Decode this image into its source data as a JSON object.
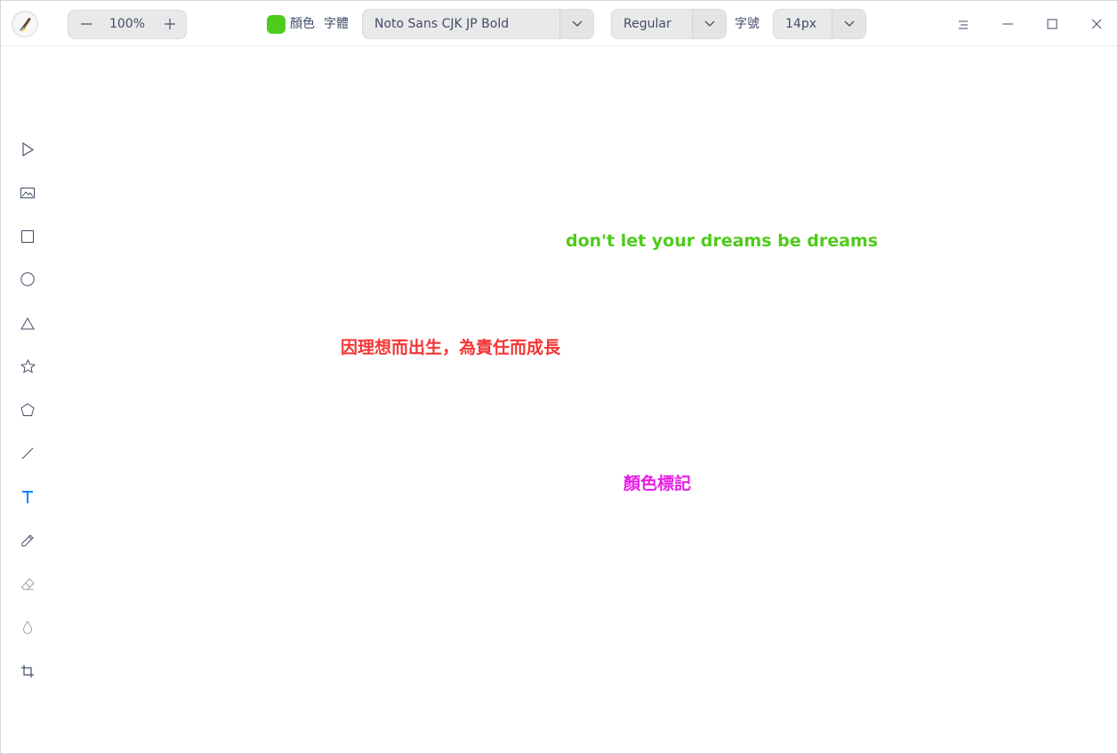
{
  "titlebar": {
    "zoom": {
      "value": "100%",
      "minus_icon": "minus-icon",
      "plus_icon": "plus-icon"
    },
    "color_label": "顏色",
    "color_value": "#4ecb1c",
    "font_label": "字體",
    "font_family": "Noto Sans CJK JP Bold",
    "font_weight": "Regular",
    "size_label": "字號",
    "font_size": "14px"
  },
  "window_controls": [
    "menu-icon",
    "minimize-icon",
    "maximize-icon",
    "close-icon"
  ],
  "tools": [
    {
      "name": "select",
      "icon": "select-arrow-icon",
      "active": false
    },
    {
      "name": "image",
      "icon": "image-icon",
      "active": false
    },
    {
      "name": "rectangle",
      "icon": "rectangle-icon",
      "active": false
    },
    {
      "name": "ellipse",
      "icon": "ellipse-icon",
      "active": false
    },
    {
      "name": "triangle",
      "icon": "triangle-icon",
      "active": false
    },
    {
      "name": "star",
      "icon": "star-icon",
      "active": false
    },
    {
      "name": "polygon",
      "icon": "polygon-icon",
      "active": false
    },
    {
      "name": "line",
      "icon": "line-icon",
      "active": false
    },
    {
      "name": "text",
      "icon": "text-icon",
      "active": true
    },
    {
      "name": "pen",
      "icon": "pen-icon",
      "active": false
    },
    {
      "name": "eraser",
      "icon": "eraser-icon",
      "active": false
    },
    {
      "name": "blur",
      "icon": "blur-drop-icon",
      "active": false
    },
    {
      "name": "crop",
      "icon": "crop-icon",
      "active": false
    }
  ],
  "canvas": {
    "texts": [
      {
        "text": "don't let your dreams be dreams",
        "color": "#4ecb1c"
      },
      {
        "text": "因理想而出生，為責任而成長",
        "color": "#f53535"
      },
      {
        "text": "顏色標記",
        "color": "#e81ee8"
      }
    ]
  },
  "colors": {
    "accent": "#0081ff",
    "toolbar_bg": "#e9e9e9",
    "text": "#414d68"
  }
}
